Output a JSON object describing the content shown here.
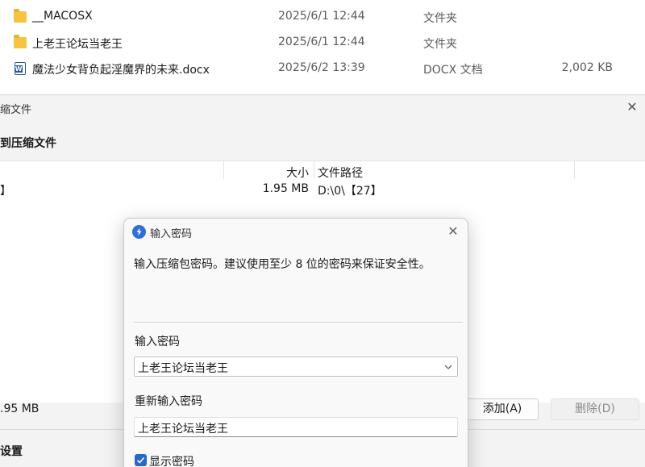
{
  "explorer": {
    "files": [
      {
        "name": "__MACOSX",
        "date": "2025/6/1 12:44",
        "type": "文件夹",
        "size": "",
        "icon": "folder-icon"
      },
      {
        "name": "上老王论坛当老王",
        "date": "2025/6/1 12:44",
        "type": "文件夹",
        "size": "",
        "icon": "folder-icon"
      },
      {
        "name": "魔法少女背负起淫魔界的未来.docx",
        "date": "2025/6/2 13:39",
        "type": "DOCX 文档",
        "size": "2,002 KB",
        "icon": "word-icon"
      }
    ]
  },
  "compress_dialog": {
    "title": "缩文件",
    "heading": "到压缩文件",
    "columns": {
      "size": "大小",
      "path": "文件路径"
    },
    "row": {
      "name": "】",
      "size": "1.95 MB",
      "path": "D:\\0\\【27】"
    },
    "total_size": ".95 MB",
    "add_label": "添加(A)",
    "delete_label": "删除(D)",
    "settings_heading": "设置"
  },
  "password_dialog": {
    "title": "输入密码",
    "description": "输入压缩包密码。建议使用至少 8 位的密码来保证安全性。",
    "password_label": "输入密码",
    "password_value": "上老王论坛当老王",
    "confirm_label": "重新输入密码",
    "confirm_value": "上老王论坛当老王",
    "show_password_label": "显示密码",
    "show_password_checked": true
  },
  "colors": {
    "accent": "#2868c9",
    "folder": "#f5c440",
    "word": "#2b5797"
  }
}
